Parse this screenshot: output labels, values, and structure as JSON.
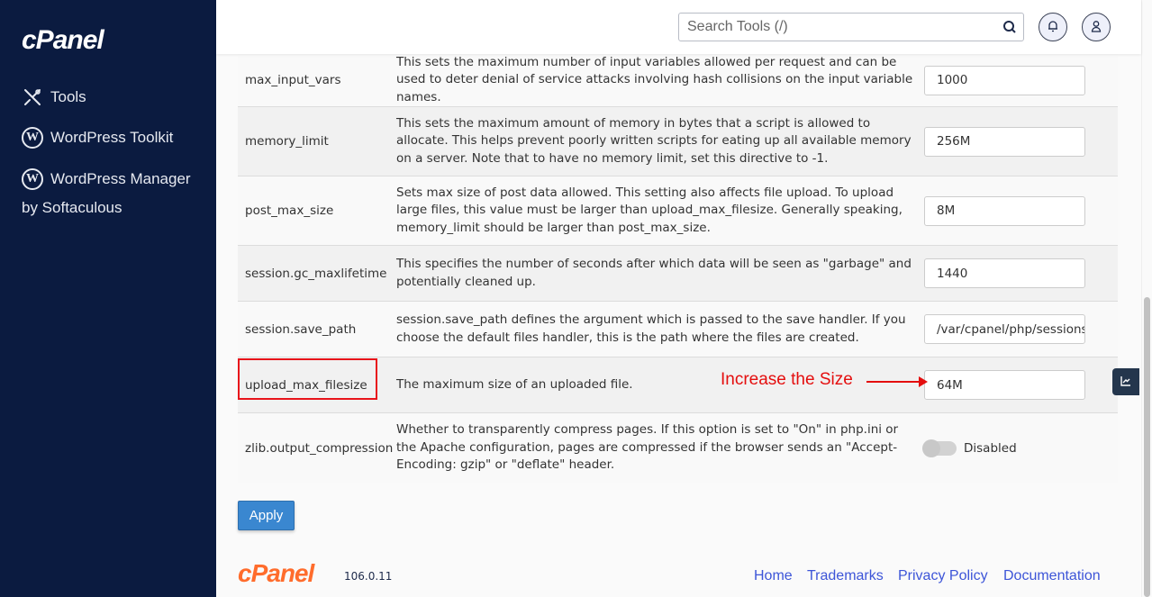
{
  "sidebar": {
    "logo": "cPanel",
    "items": [
      {
        "label": "Tools",
        "icon": "tools-icon"
      },
      {
        "label": "WordPress Toolkit",
        "icon": "wordpress-icon"
      },
      {
        "label": "WordPress Manager",
        "sublabel": "by Softaculous",
        "icon": "wordpress-icon"
      }
    ]
  },
  "header": {
    "search_placeholder": "Search Tools (/)",
    "search_icon": "search-icon",
    "notifications_icon": "bell-icon",
    "user_icon": "user-icon"
  },
  "settings": [
    {
      "name": "max_input_vars",
      "description": "This sets the maximum number of input variables allowed per request and can be used to deter denial of service attacks involving hash collisions on the input variable names.",
      "value": "1000"
    },
    {
      "name": "memory_limit",
      "description": "This sets the maximum amount of memory in bytes that a script is allowed to allocate. This helps prevent poorly written scripts for eating up all available memory on a server. Note that to have no memory limit, set this directive to -1.",
      "value": "256M"
    },
    {
      "name": "post_max_size",
      "description": "Sets max size of post data allowed. This setting also affects file upload. To upload large files, this value must be larger than upload_max_filesize. Generally speaking, memory_limit should be larger than post_max_size.",
      "value": "8M"
    },
    {
      "name": "session.gc_maxlifetime",
      "description": "This specifies the number of seconds after which data will be seen as \"garbage\" and potentially cleaned up.",
      "value": "1440"
    },
    {
      "name": "session.save_path",
      "description": "session.save_path defines the argument which is passed to the save handler. If you choose the default files handler, this is the path where the files are created.",
      "value": "/var/cpanel/php/sessions"
    },
    {
      "name": "upload_max_filesize",
      "description": "The maximum size of an uploaded file.",
      "value": "64M"
    },
    {
      "name": "zlib.output_compression",
      "description": "Whether to transparently compress pages. If this option is set to \"On\" in php.ini or the Apache configuration, pages are compressed if the browser sends an \"Accept-Encoding: gzip\" or \"deflate\" header.",
      "toggle_state": "Disabled"
    }
  ],
  "annotation": {
    "text": "Increase the Size",
    "color": "#e40e0e"
  },
  "apply_label": "Apply",
  "footer": {
    "logo": "cPanel",
    "version": "106.0.11",
    "links": [
      "Home",
      "Trademarks",
      "Privacy Policy",
      "Documentation"
    ]
  },
  "colors": {
    "sidebar_bg": "#0b1b40",
    "apply_bg": "#3a87d0",
    "footer_logo": "#ff6c2c",
    "link": "#3d55d8",
    "highlight": "#e8141b"
  }
}
